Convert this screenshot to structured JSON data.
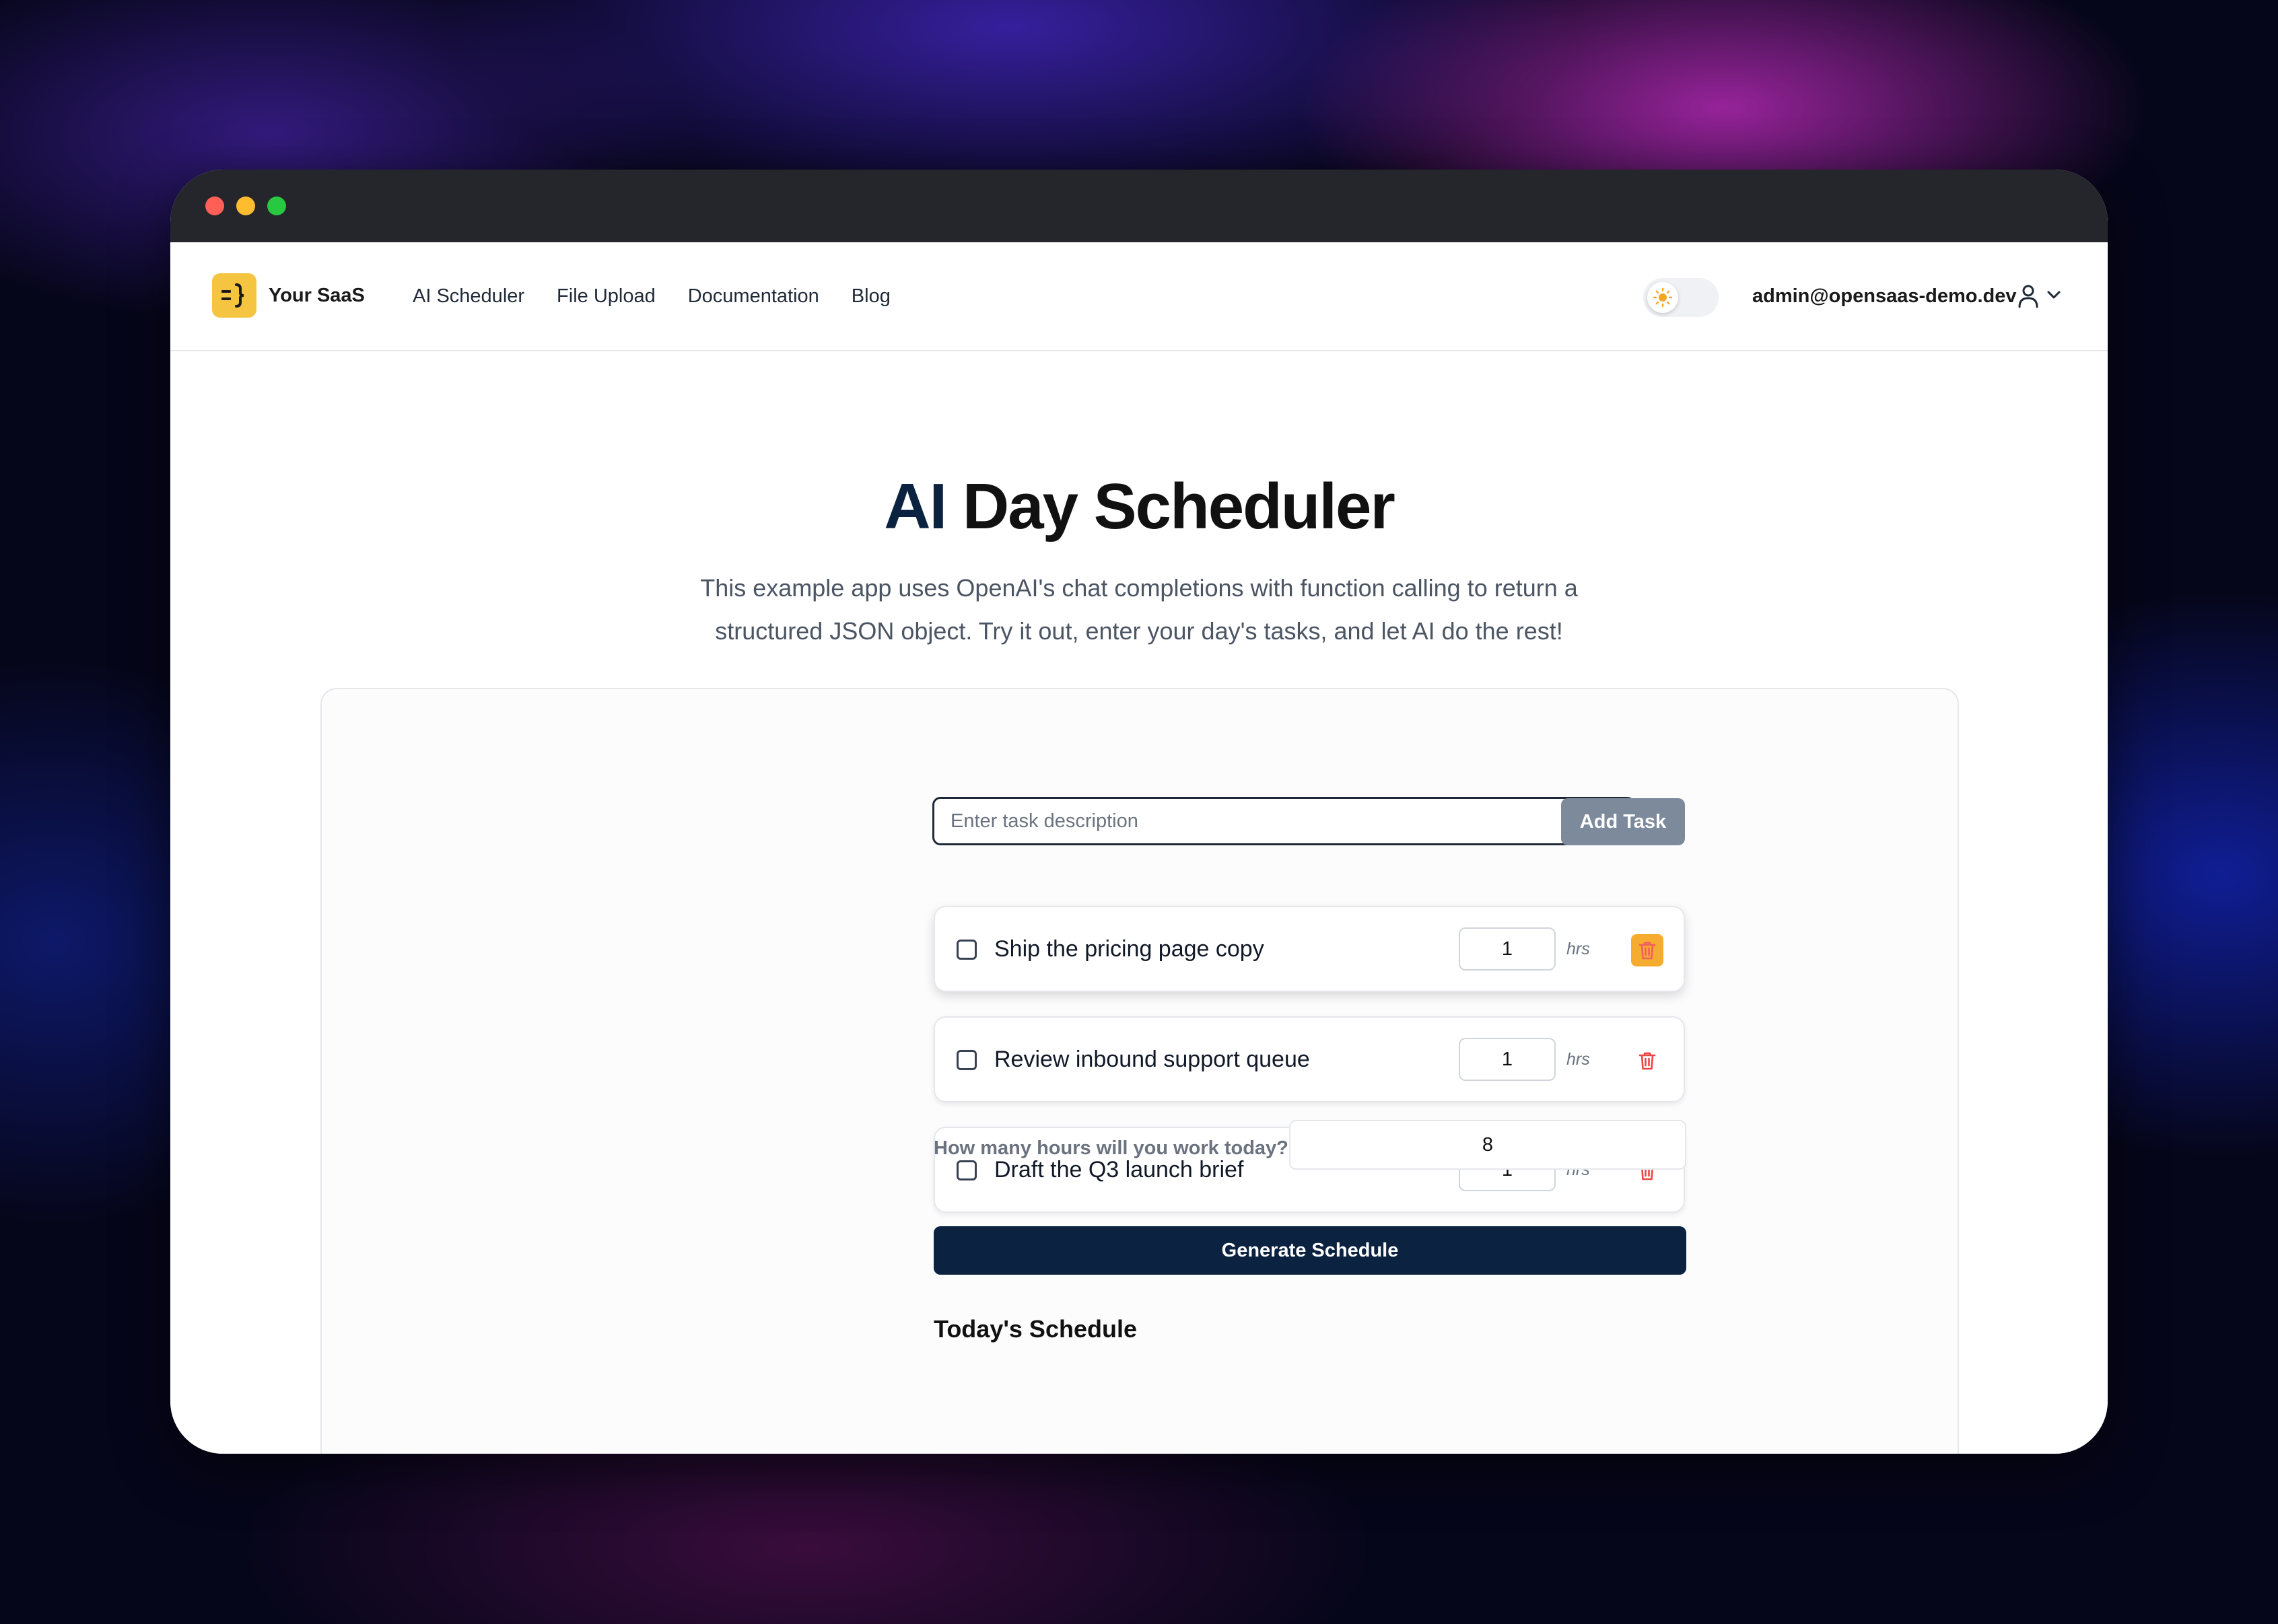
{
  "navbar": {
    "brand": "Your SaaS",
    "links": [
      "AI Scheduler",
      "File Upload",
      "Documentation",
      "Blog"
    ],
    "user_email": "admin@opensaas-demo.dev"
  },
  "hero": {
    "title_accent": "AI",
    "title_rest": "Day Scheduler",
    "subtitle": "This example app uses OpenAI's chat completions with function calling to return a structured JSON object. Try it out, enter your day's tasks, and let AI do the rest!"
  },
  "form": {
    "task_placeholder": "Enter task description",
    "add_task_label": "Add Task",
    "tasks": [
      {
        "description": "Ship the pricing page copy",
        "hours": "1",
        "unit": "hrs"
      },
      {
        "description": "Review inbound support queue",
        "hours": "1",
        "unit": "hrs"
      },
      {
        "description": "Draft the Q3 launch brief",
        "hours": "1",
        "unit": "hrs"
      }
    ],
    "work_hours_label": "How many hours will you work today?",
    "work_hours_value": "8",
    "generate_label": "Generate Schedule",
    "schedule_heading": "Today's Schedule"
  },
  "colors": {
    "brand_yellow": "#f5c542",
    "primary_navy": "#0b2240",
    "delete_red": "#ef4444"
  },
  "icons": {
    "logo": "brace-logo-icon",
    "theme": "sun-icon",
    "user": "user-icon",
    "menu": "chevron-down-icon",
    "delete": "trash-icon"
  }
}
